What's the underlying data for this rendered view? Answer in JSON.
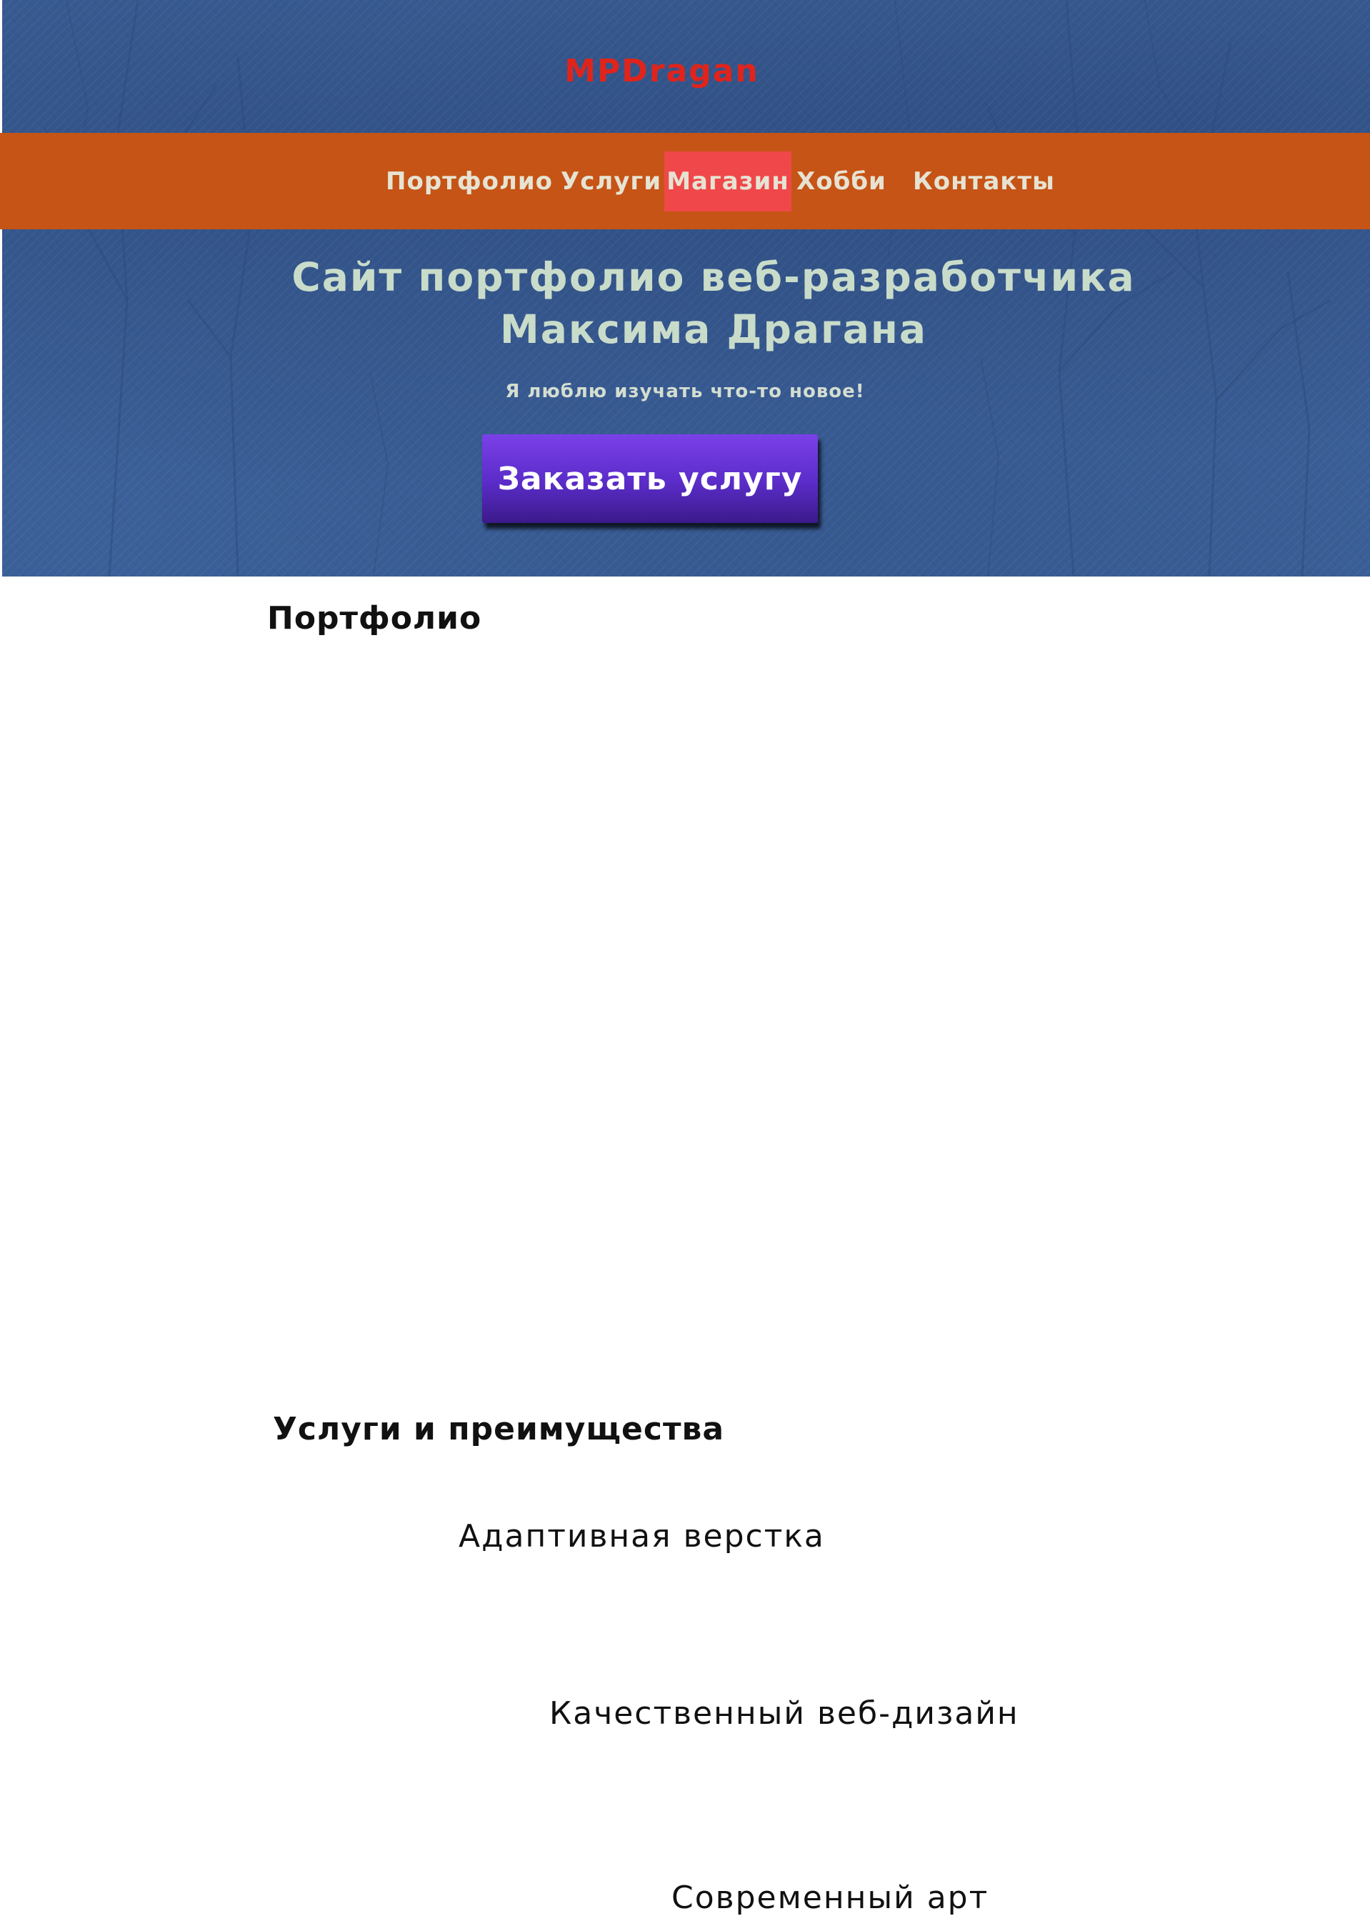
{
  "header": {
    "logo": "MPDragan"
  },
  "nav": {
    "items": [
      {
        "label": "Портфолио"
      },
      {
        "label": "Услуги"
      },
      {
        "label": "Магазин",
        "active": true
      },
      {
        "label": "Хобби"
      },
      {
        "label": "Контакты"
      }
    ]
  },
  "hero": {
    "title_line1": "Сайт портфолио веб-разработчика",
    "title_line2": "Максима Драгана",
    "subtitle": "Я люблю изучать что-то новое!",
    "cta_label": "Заказать услугу"
  },
  "portfolio": {
    "heading": "Портфолио"
  },
  "services": {
    "heading": "Услуги и преимущества",
    "items": [
      {
        "label": "Адаптивная верстка"
      },
      {
        "label": "Качественный веб-дизайн"
      },
      {
        "label": "Современный арт"
      }
    ]
  },
  "colors": {
    "hero_background": "#3b5f98",
    "nav_background": "#c65416",
    "nav_active": "#f0484a",
    "logo": "#e0241b",
    "hero_text": "#c9dcca",
    "button": "#5a2cc8"
  }
}
